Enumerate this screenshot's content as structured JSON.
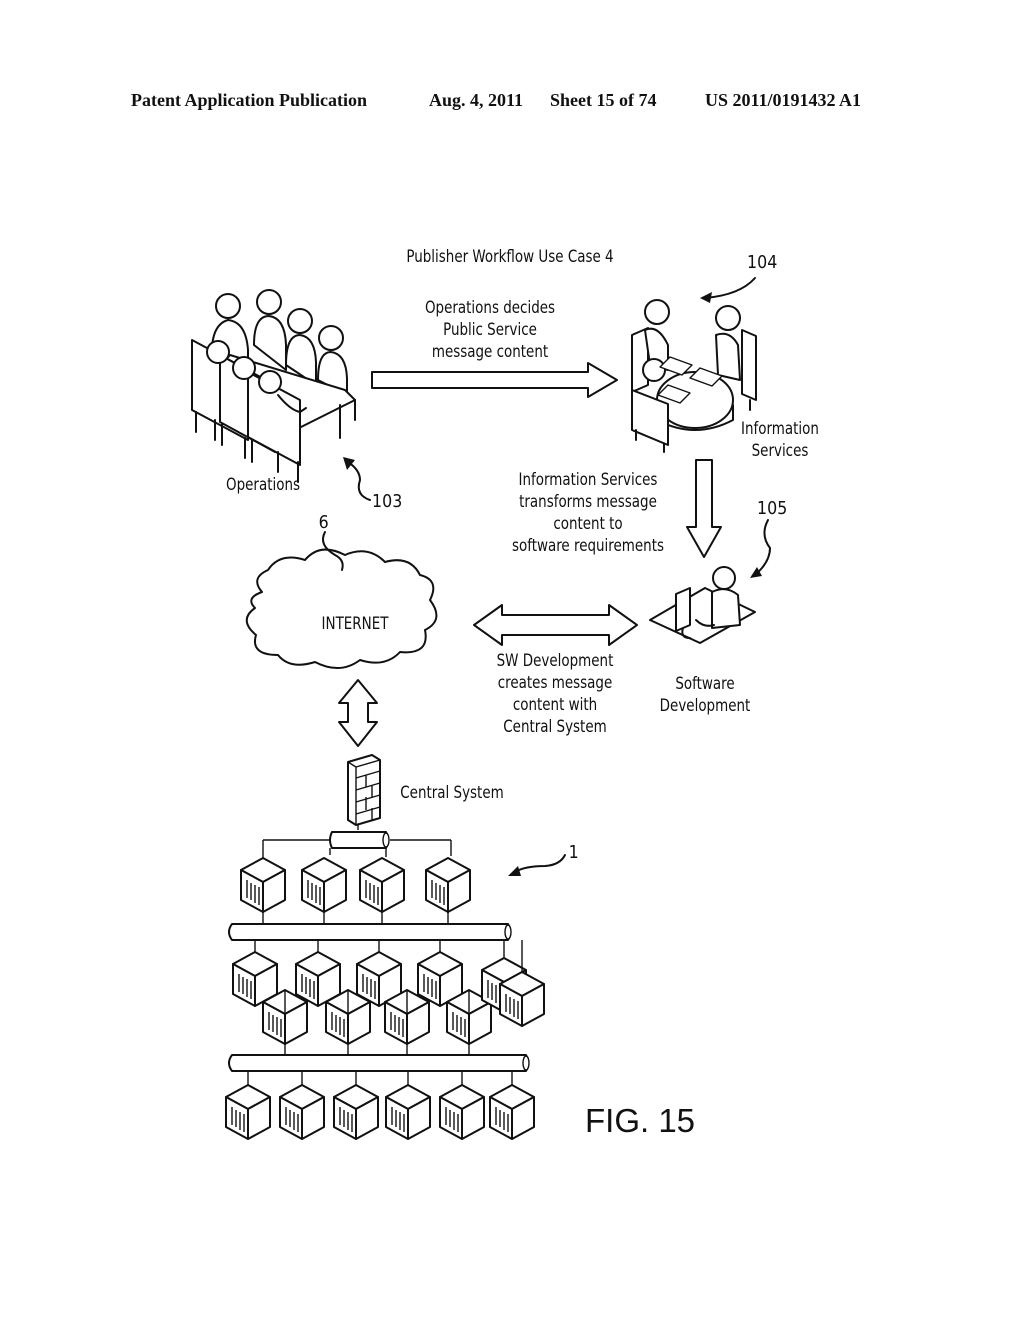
{
  "header": {
    "publication": "Patent Application Publication",
    "date": "Aug. 4, 2011",
    "sheet": "Sheet 15 of 74",
    "patent_number": "US 2011/0191432 A1"
  },
  "diagram": {
    "title": "Publisher Workflow Use Case 4",
    "figure_label": "FIG. 15",
    "nodes": {
      "operations": {
        "label": "Operations",
        "ref": "103"
      },
      "information_services": {
        "label_lines": [
          "Information",
          "Services"
        ],
        "ref": "104"
      },
      "software_development": {
        "label_lines": [
          "Software",
          "Development"
        ],
        "ref": "105"
      },
      "internet": {
        "label": "INTERNET",
        "ref": "6"
      },
      "central_system": {
        "label": "Central System",
        "ref": "1"
      }
    },
    "edges": {
      "ops_to_info": {
        "lines": [
          "Operations decides",
          "Public Service",
          "message content"
        ]
      },
      "info_to_sw": {
        "lines": [
          "Information Services",
          "transforms message",
          "content to",
          "software requirements"
        ]
      },
      "sw_internet": {
        "lines": [
          "SW Development",
          "creates message",
          "content with",
          "Central System"
        ]
      }
    }
  }
}
